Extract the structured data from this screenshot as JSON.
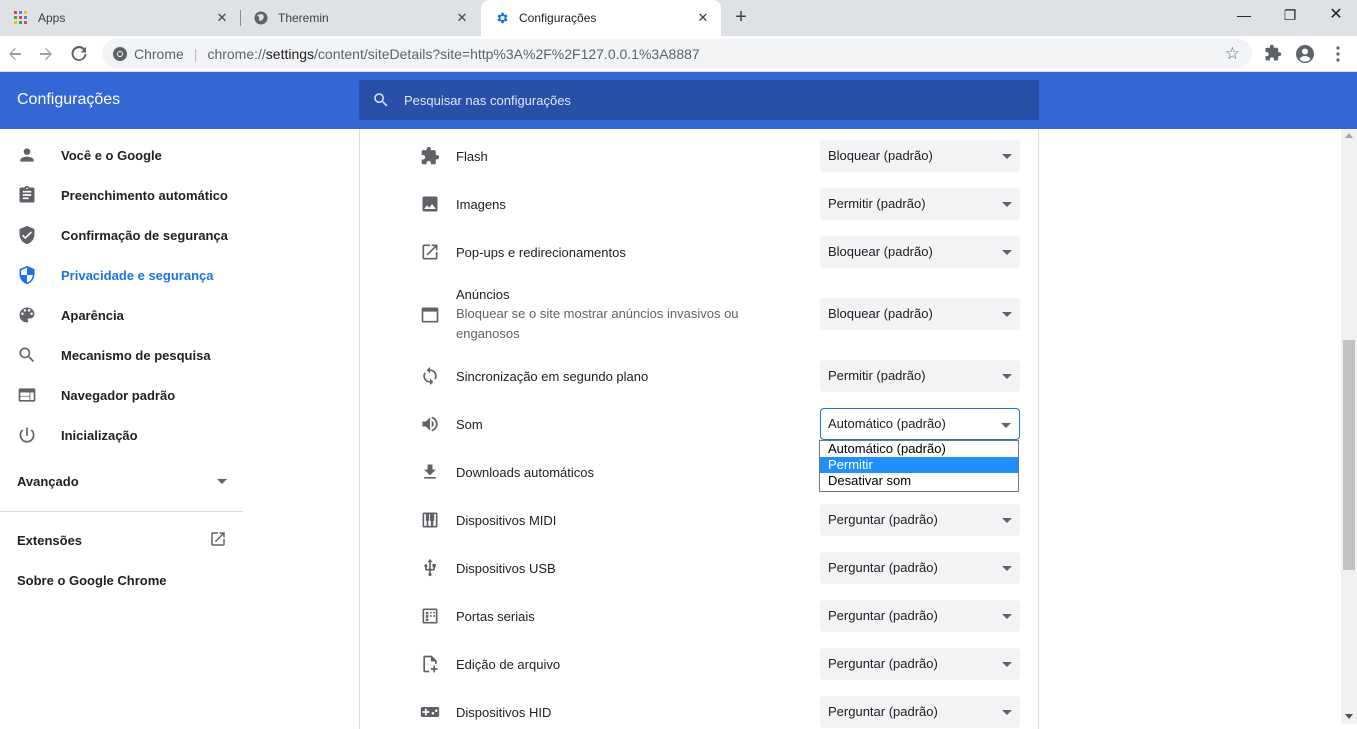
{
  "browser": {
    "tabs": [
      {
        "title": "Apps",
        "icon": "apps-grid-icon"
      },
      {
        "title": "Theremin",
        "icon": "globe-icon"
      },
      {
        "title": "Configurações",
        "icon": "settings-gear-icon"
      }
    ],
    "new_tab": "+",
    "close": "✕",
    "window": {
      "minimize": "—",
      "restore": "❐",
      "close": "✕"
    },
    "omnibox": {
      "chip": "Chrome",
      "url_prefix": "chrome://",
      "url_host": "settings",
      "url_path": "/content/siteDetails?site=http%3A%2F%2F127.0.0.1%3A8887"
    }
  },
  "settings": {
    "title": "Configurações",
    "search_placeholder": "Pesquisar nas configurações"
  },
  "sidebar": {
    "items": [
      {
        "label": "Você e o Google",
        "icon": "person-icon"
      },
      {
        "label": "Preenchimento automático",
        "icon": "clipboard-icon"
      },
      {
        "label": "Confirmação de segurança",
        "icon": "shield-check-icon"
      },
      {
        "label": "Privacidade e segurança",
        "icon": "shield-icon",
        "active": true
      },
      {
        "label": "Aparência",
        "icon": "palette-icon"
      },
      {
        "label": "Mecanismo de pesquisa",
        "icon": "search-icon"
      },
      {
        "label": "Navegador padrão",
        "icon": "browser-window-icon"
      },
      {
        "label": "Inicialização",
        "icon": "power-icon"
      }
    ],
    "advanced": "Avançado",
    "extensions": "Extensões",
    "about": "Sobre o Google Chrome"
  },
  "permissions": [
    {
      "label": "Flash",
      "value": "Bloquear (padrão)",
      "icon": "puzzle-icon"
    },
    {
      "label": "Imagens",
      "value": "Permitir (padrão)",
      "icon": "image-icon"
    },
    {
      "label": "Pop-ups e redirecionamentos",
      "value": "Bloquear (padrão)",
      "icon": "open-in-new-icon"
    },
    {
      "label": "Anúncios",
      "sub": "Bloquear se o site mostrar anúncios invasivos ou enganosos",
      "value": "Bloquear (padrão)",
      "icon": "ad-window-icon"
    },
    {
      "label": "Sincronização em segundo plano",
      "value": "Permitir (padrão)",
      "icon": "sync-icon"
    },
    {
      "label": "Som",
      "value": "Automático (padrão)",
      "icon": "volume-icon",
      "open": true
    },
    {
      "label": "Downloads automáticos",
      "value": "",
      "icon": "download-icon"
    },
    {
      "label": "Dispositivos MIDI",
      "value": "Perguntar (padrão)",
      "icon": "piano-icon"
    },
    {
      "label": "Dispositivos USB",
      "value": "Perguntar (padrão)",
      "icon": "usb-icon"
    },
    {
      "label": "Portas seriais",
      "value": "Perguntar (padrão)",
      "icon": "serial-port-icon"
    },
    {
      "label": "Edição de arquivo",
      "value": "Perguntar (padrão)",
      "icon": "file-edit-icon"
    },
    {
      "label": "Dispositivos HID",
      "value": "Perguntar (padrão)",
      "icon": "gamepad-icon"
    }
  ],
  "sound_dropdown": {
    "options": [
      "Automático (padrão)",
      "Permitir",
      "Desativar som"
    ],
    "highlighted": "Permitir"
  },
  "colors": {
    "header": "#3367d6",
    "search": "#2850a8",
    "accent": "#1a73e8"
  }
}
